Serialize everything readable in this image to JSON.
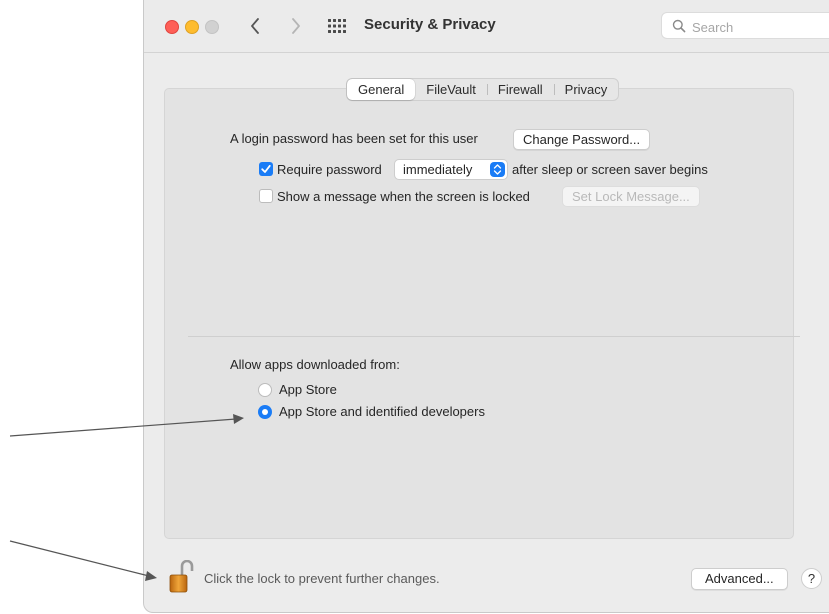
{
  "window": {
    "title": "Security & Privacy",
    "search_placeholder": "Search"
  },
  "tabs": [
    {
      "label": "General",
      "active": true
    },
    {
      "label": "FileVault",
      "active": false
    },
    {
      "label": "Firewall",
      "active": false
    },
    {
      "label": "Privacy",
      "active": false
    }
  ],
  "general": {
    "login_text": "A login password has been set for this user",
    "change_password_label": "Change Password...",
    "require_password_label": "Require password",
    "require_password_checked": true,
    "require_password_delay": "immediately",
    "after_sleep_text": "after sleep or screen saver begins",
    "show_message_label": "Show a message when the screen is locked",
    "show_message_checked": false,
    "set_lock_message_label": "Set Lock Message..."
  },
  "downloads": {
    "heading": "Allow apps downloaded from:",
    "options": [
      {
        "label": "App Store",
        "selected": false
      },
      {
        "label": "App Store and identified developers",
        "selected": true
      }
    ]
  },
  "footer": {
    "lock_text": "Click the lock to prevent further changes.",
    "advanced_label": "Advanced...",
    "help_label": "?"
  },
  "colors": {
    "accent": "#1a7cf6",
    "close": "#fe5f57",
    "minimize": "#febc2e",
    "lock_body": "#d98a1f"
  },
  "icons": [
    "chevron-left-icon",
    "chevron-right-icon",
    "grid-icon",
    "search-icon",
    "checkmark-icon",
    "stepper-icon",
    "lock-open-icon"
  ]
}
